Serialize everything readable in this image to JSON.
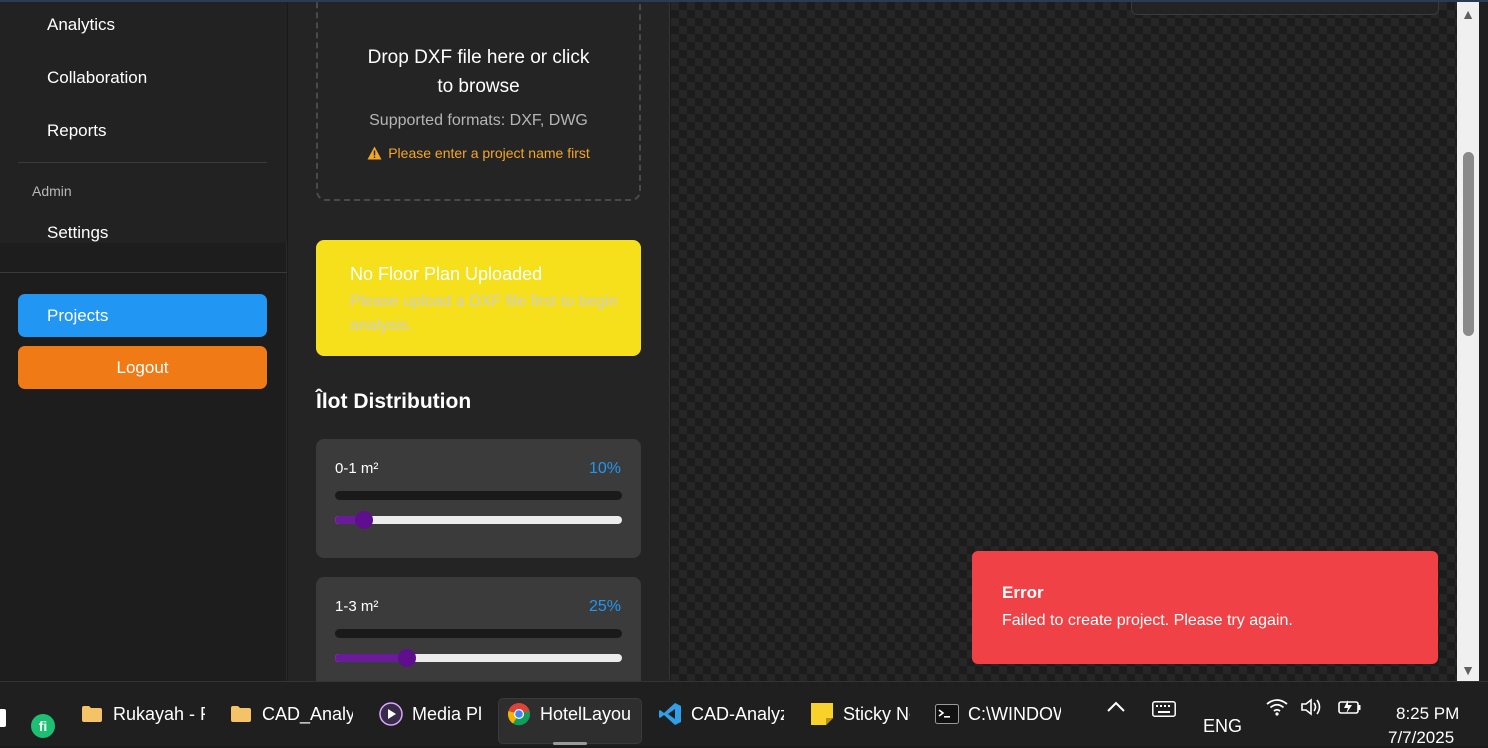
{
  "sidebar": {
    "nav_items": [
      "Analytics",
      "Collaboration",
      "Reports"
    ],
    "admin_section": "Admin",
    "admin_items": [
      "Settings"
    ],
    "projects_button": "Projects",
    "logout_button": "Logout"
  },
  "upload": {
    "title": "Drop DXF file here or click to browse",
    "formats": "Supported formats: DXF, DWG",
    "warning": "Please enter a project name first"
  },
  "notice": {
    "title": "No Floor Plan Uploaded",
    "body": "Please upload a DXF file first to begin analysis."
  },
  "distribution": {
    "heading": "Îlot Distribution",
    "items": [
      {
        "label": "0-1 m²",
        "percent_text": "10%",
        "value": 0.1
      },
      {
        "label": "1-3 m²",
        "percent_text": "25%",
        "value": 0.25
      }
    ]
  },
  "toast": {
    "title": "Error",
    "message": "Failed to create project. Please try again."
  },
  "taskbar": {
    "apps": [
      {
        "label": "Rukayah - F",
        "icon": "folder-icon"
      },
      {
        "label": "CAD_Analyz",
        "icon": "folder-icon"
      },
      {
        "label": "Media Pl",
        "icon": "media-player-icon"
      },
      {
        "label": "HotelLayou",
        "icon": "chrome-icon"
      },
      {
        "label": "CAD-Analyz",
        "icon": "vscode-icon"
      },
      {
        "label": "Sticky No",
        "icon": "sticky-notes-icon"
      },
      {
        "label": "C:\\WINDOW",
        "icon": "terminal-icon"
      }
    ],
    "language": "ENG",
    "time": "8:25 PM",
    "date": "7/7/2025"
  },
  "colors": {
    "projects": "#2196f3",
    "logout": "#f07b16",
    "notice": "#f5e01b",
    "error": "#ef4146",
    "percent": "#2196f3",
    "slider_fill": "#6a1b9a",
    "warning": "#f5a623"
  }
}
